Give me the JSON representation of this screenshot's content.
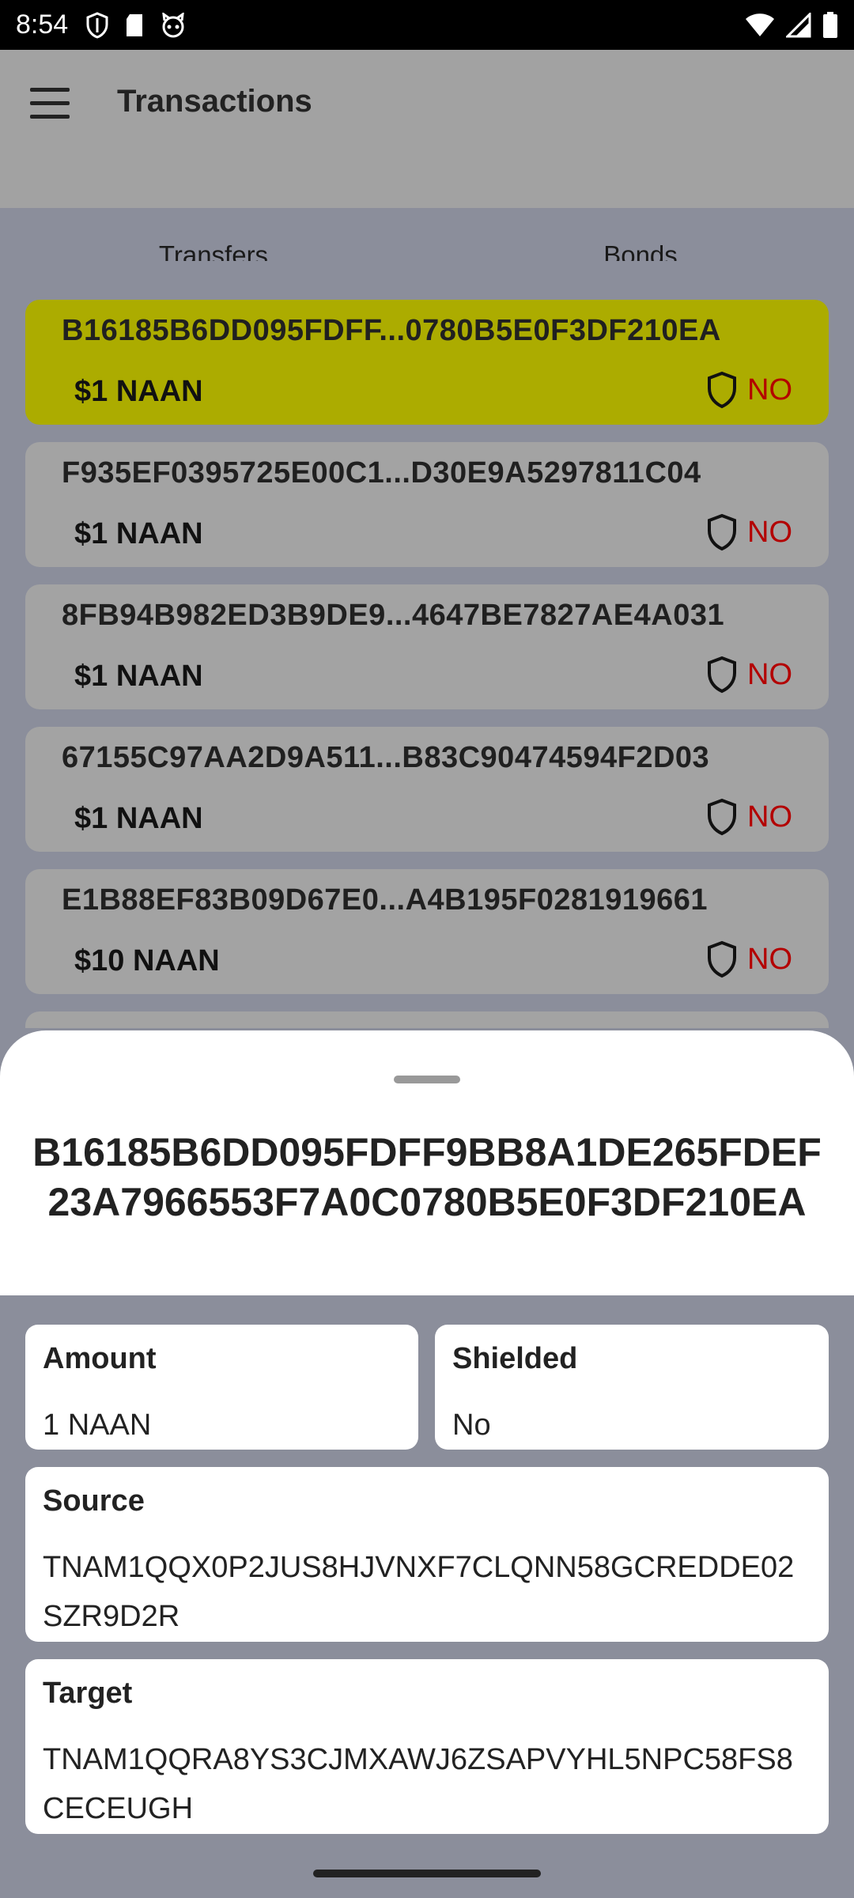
{
  "status_bar": {
    "time": "8:54",
    "left_icons": [
      "shield-icon",
      "sd-card-icon",
      "cat-face-icon"
    ],
    "right_icons": [
      "wifi-icon",
      "signal-icon",
      "battery-icon"
    ]
  },
  "app_bar": {
    "title": "Transactions",
    "menu_icon": "hamburger-menu-icon"
  },
  "tabs": [
    {
      "label": "Transfers",
      "selected": true
    },
    {
      "label": "Bonds",
      "selected": false
    }
  ],
  "transactions": [
    {
      "hash": "B16185B6DD095FDFF...0780B5E0F3DF210EA",
      "amount": "$1 NAAN",
      "shielded": "NO",
      "selected": true
    },
    {
      "hash": "F935EF0395725E00C1...D30E9A5297811C04",
      "amount": "$1 NAAN",
      "shielded": "NO",
      "selected": false
    },
    {
      "hash": "8FB94B982ED3B9DE9...4647BE7827AE4A031",
      "amount": "$1 NAAN",
      "shielded": "NO",
      "selected": false
    },
    {
      "hash": "67155C97AA2D9A511...B83C90474594F2D03",
      "amount": "$1 NAAN",
      "shielded": "NO",
      "selected": false
    },
    {
      "hash": "E1B88EF83B09D67E0...A4B195F0281919661",
      "amount": "$10 NAAN",
      "shielded": "NO",
      "selected": false
    }
  ],
  "sheet": {
    "title": "B16185B6DD095FDFF9BB8A1DE265FDEF23A7966553F7A0C0780B5E0F3DF210EA",
    "amount_label": "Amount",
    "amount_value": "1 NAAN",
    "shielded_label": "Shielded",
    "shielded_value": "No",
    "source_label": "Source",
    "source_value": "TNAM1QQX0P2JUS8HJVNXF7CLQNN58GCREDDE02SZR9D2R",
    "target_label": "Target",
    "target_value": "TNAM1QQRA8YS3CJMXAWJ6ZSAPVYHL5NPC58FS8CECEUGH"
  },
  "colors": {
    "selected_card": "#acac00",
    "card": "#a3a3a3",
    "shield_no": "#b30000",
    "scrim": "#8b8e9b"
  }
}
